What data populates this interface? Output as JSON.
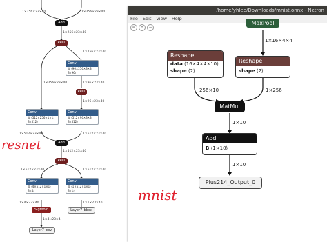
{
  "left_graph": {
    "top_labels": [
      "1×256×23×40",
      "1×256×23×40"
    ],
    "add_label": "Add",
    "relu_label": "Relu",
    "conv_label": "Conv",
    "sigmoid_label": "Sigmoid",
    "edges": [
      "1×256×23×40",
      "1×256×23×40",
      "1×256×23×40",
      "1×96×23×40",
      "1×96×23×40",
      "1×512×23×40",
      "1×512×23×40",
      "1×512×23×40",
      "1×512×23×40",
      "1×512×23×40",
      "1×4×23×40",
      "1×1×23×40",
      "1×4×23×4"
    ],
    "conv_rows": {
      "top": [
        "W ⟨96×256×3×3⟩",
        "B ⟨96⟩"
      ],
      "left_mid": [
        "W ⟨512×256×1×1⟩",
        "B ⟨512⟩"
      ],
      "right_mid": [
        "W ⟨512×96×3×3⟩",
        "B ⟨512⟩"
      ],
      "bottom_left": [
        "W ⟨4×512×1×1⟩",
        "B ⟨4⟩"
      ],
      "bottom_right": [
        "W ⟨1×512×1×1⟩",
        "B ⟨1⟩"
      ]
    },
    "outputs": [
      "Layer7_cov",
      "Layer7_bbox"
    ],
    "handwritten_note": "resnet"
  },
  "window": {
    "title": "/home/yhlee/Downloads/mnist.onnx - Netron",
    "menu": [
      "File",
      "Edit",
      "View",
      "Help"
    ]
  },
  "netron_graph": {
    "maxpool_label": "MaxPool",
    "maxpool_out": "1×16×4×4",
    "reshape_left": {
      "title": "Reshape",
      "data_key": "data",
      "data_val": "⟨16×4×4×10⟩",
      "shape_key": "shape",
      "shape_val": "⟨2⟩"
    },
    "reshape_right": {
      "title": "Reshape",
      "shape_key": "shape",
      "shape_val": "⟨2⟩"
    },
    "edge_left": "256×10",
    "edge_right": "1×256",
    "matmul_label": "MatMul",
    "matmul_out": "1×10",
    "add": {
      "title": "Add",
      "b_key": "B",
      "b_val": "⟨1×10⟩"
    },
    "add_out": "1×10",
    "output_label": "Plus214_Output_0",
    "handwritten_note": "mnist"
  },
  "colors": {
    "conv_header": "#335c8a",
    "relu": "#6e1f1f",
    "reshape_header": "#6b3e3a",
    "maxpool": "#2c5e3a",
    "handwriting": "#e0202d"
  }
}
